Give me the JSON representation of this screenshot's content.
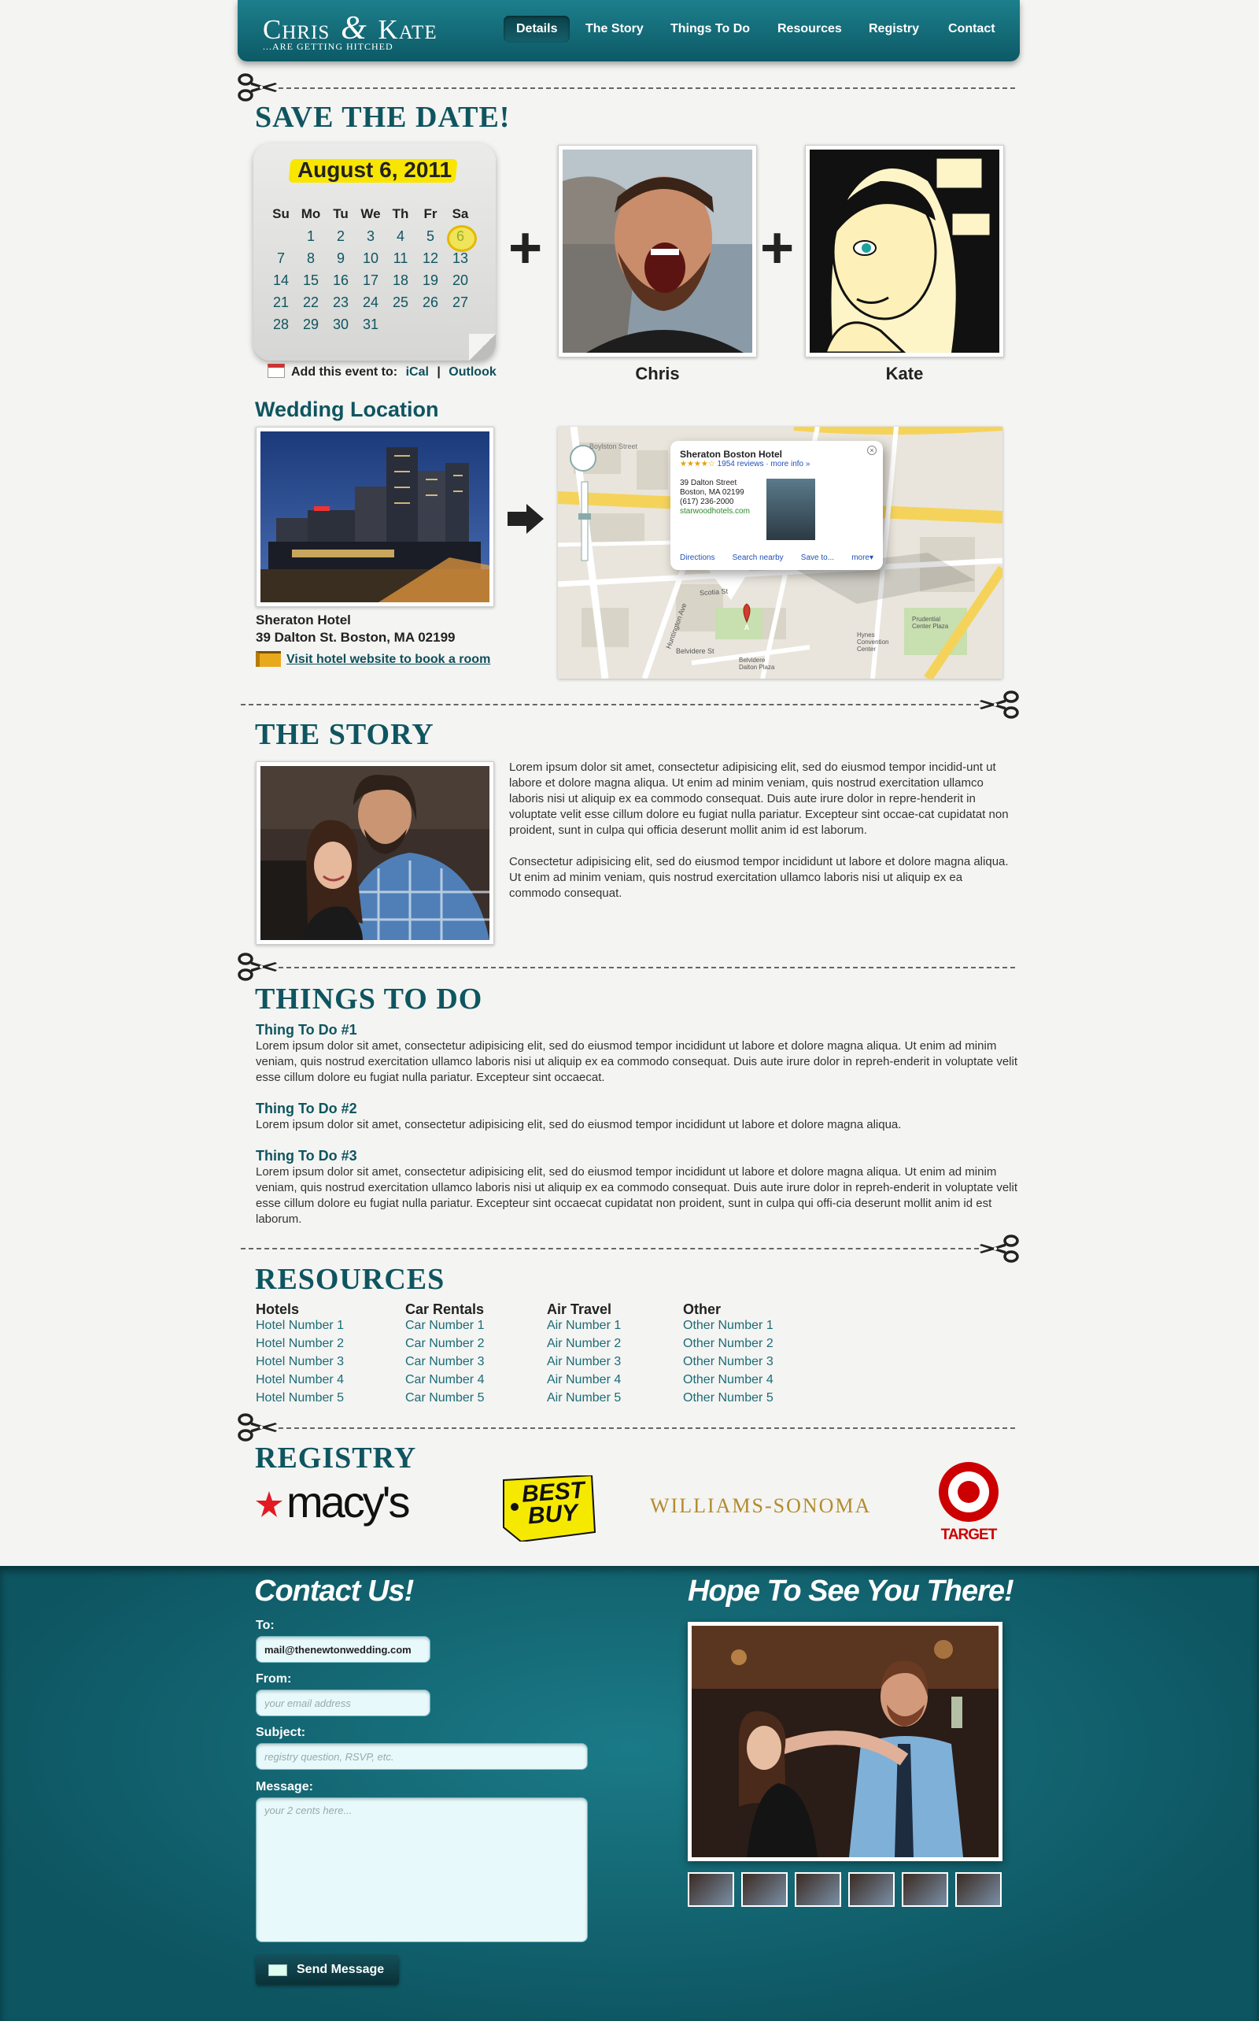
{
  "brand": {
    "title_a": "Chris",
    "title_amp": "&",
    "title_b": "Kate",
    "subtitle": "...are getting hitched"
  },
  "nav": [
    {
      "label": "Details",
      "active": true
    },
    {
      "label": "The Story"
    },
    {
      "label": "Things To Do"
    },
    {
      "label": "Resources"
    },
    {
      "label": "Registry"
    },
    {
      "label": "Contact"
    }
  ],
  "save_the_date": {
    "title": "Save the Date!",
    "date": "August 6, 2011",
    "weekdays": [
      "Su",
      "Mo",
      "Tu",
      "We",
      "Th",
      "Fr",
      "Sa"
    ],
    "weeks": [
      [
        "",
        "1",
        "2",
        "3",
        "4",
        "5",
        "6"
      ],
      [
        "7",
        "8",
        "9",
        "10",
        "11",
        "12",
        "13"
      ],
      [
        "14",
        "15",
        "16",
        "17",
        "18",
        "19",
        "20"
      ],
      [
        "21",
        "22",
        "23",
        "24",
        "25",
        "26",
        "27"
      ],
      [
        "28",
        "29",
        "30",
        "31",
        "",
        "",
        ""
      ]
    ],
    "highlighted_day": "6",
    "add_event_label": "Add this event to:",
    "ical": "iCal",
    "separator": "|",
    "outlook": "Outlook",
    "person1": "Chris",
    "person2": "Kate",
    "plus": "+"
  },
  "location": {
    "title": "Wedding Location",
    "hotel_name": "Sheraton Hotel",
    "hotel_address": "39 Dalton St. Boston, MA 02199",
    "visit_link": "Visit hotel website to book a room",
    "map": {
      "popup_title": "Sheraton Boston Hotel",
      "rating_stars": "★★★★☆",
      "reviews": "1954 reviews",
      "more_info": "· more info »",
      "address_lines": [
        "39 Dalton Street",
        "Boston, MA 02199",
        "(617) 236-2000"
      ],
      "website": "starwoodhotels.com",
      "actions": [
        "Directions",
        "Search nearby",
        "Save to...",
        "more▾"
      ],
      "streets": [
        "Boylston Street",
        "Belvidere St",
        "Scotia St",
        "Huntington Ave",
        "Dalton St",
        "Prudential Center Plaza",
        "Hynes Convention Center",
        "Belvidere Dalton Plaza"
      ],
      "marker": "A"
    }
  },
  "story": {
    "title": "The Story",
    "p1": "Lorem ipsum dolor sit amet, consectetur adipisicing elit, sed do eiusmod tempor incidid-unt ut labore et dolore magna aliqua. Ut enim ad minim veniam, quis nostrud exercitation ullamco laboris nisi ut aliquip ex ea commodo consequat. Duis aute irure dolor in repre-henderit in voluptate velit esse cillum dolore eu fugiat nulla pariatur. Excepteur sint occae-cat cupidatat non proident, sunt in culpa qui officia deserunt mollit anim id est laborum.",
    "p2": "Consectetur adipisicing elit, sed do eiusmod tempor incididunt ut labore et dolore magna aliqua. Ut enim ad minim veniam, quis nostrud exercitation ullamco laboris nisi ut aliquip ex ea commodo consequat."
  },
  "things": {
    "title": "Things To Do",
    "items": [
      {
        "title": "Thing To Do #1",
        "text": "Lorem ipsum dolor sit amet, consectetur adipisicing elit, sed do eiusmod tempor incididunt ut labore et dolore magna aliqua. Ut enim ad minim veniam, quis nostrud exercitation ullamco laboris nisi ut aliquip ex ea commodo consequat. Duis aute irure dolor in repreh-enderit in voluptate velit esse cillum dolore eu fugiat nulla pariatur. Excepteur sint occaecat."
      },
      {
        "title": "Thing To Do #2",
        "text": "Lorem ipsum dolor sit amet, consectetur adipisicing elit, sed do eiusmod tempor incididunt ut labore et dolore magna aliqua."
      },
      {
        "title": "Thing To Do #3",
        "text": "Lorem ipsum dolor sit amet, consectetur adipisicing elit, sed do eiusmod tempor incididunt ut labore et dolore magna aliqua. Ut enim ad minim veniam, quis nostrud exercitation ullamco laboris nisi ut aliquip ex ea commodo consequat. Duis aute irure dolor in repreh-enderit in voluptate velit esse cillum dolore eu fugiat nulla pariatur. Excepteur sint occaecat cupidatat non proident, sunt in culpa qui offi-cia deserunt mollit anim id est laborum."
      }
    ]
  },
  "resources": {
    "title": "Resources",
    "columns": [
      {
        "heading": "Hotels",
        "items": [
          "Hotel Number 1",
          "Hotel Number 2",
          "Hotel Number 3",
          "Hotel Number 4",
          "Hotel Number 5"
        ]
      },
      {
        "heading": "Car Rentals",
        "items": [
          "Car Number 1",
          "Car Number 2",
          "Car Number 3",
          "Car Number 4",
          "Car Number 5"
        ]
      },
      {
        "heading": "Air Travel",
        "items": [
          "Air Number 1",
          "Air Number 2",
          "Air Number 3",
          "Air Number 4",
          "Air Number 5"
        ]
      },
      {
        "heading": "Other",
        "items": [
          "Other Number 1",
          "Other Number 2",
          "Other Number 3",
          "Other Number 4",
          "Other Number 5"
        ]
      }
    ]
  },
  "registry": {
    "title": "Registry",
    "macys": "macy's",
    "bestbuy_1": "BEST",
    "bestbuy_2": "BUY",
    "williams": "WILLIAMS-SONOMA",
    "target": "TARGET"
  },
  "contact": {
    "title": "Contact Us!",
    "to_label": "To:",
    "to_value": "mail@thenewtonwedding.com",
    "from_label": "From:",
    "from_placeholder": "your email address",
    "subject_label": "Subject:",
    "subject_placeholder": "registry question, RSVP, etc.",
    "message_label": "Message:",
    "message_placeholder": "your 2 cents here...",
    "send_label": "Send Message"
  },
  "gallery": {
    "title": "Hope To See You There!"
  },
  "colors": {
    "teal": "#0e5560",
    "highlight": "#f9e600",
    "target_red": "#cc0000",
    "macys_red": "#e21a23"
  }
}
